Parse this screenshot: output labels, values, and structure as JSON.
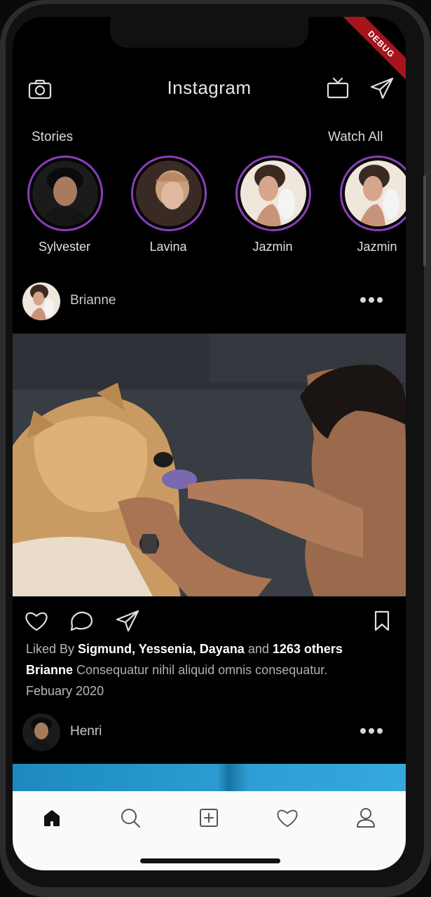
{
  "appbar": {
    "title": "Instagram",
    "left_icon": "camera-icon",
    "right_icons": [
      "tv-icon",
      "send-icon"
    ],
    "debug_banner": "DEBUG"
  },
  "stories": {
    "title": "Stories",
    "watch_all": "Watch All",
    "items": [
      {
        "name": "Sylvester"
      },
      {
        "name": "Lavina"
      },
      {
        "name": "Jazmin"
      },
      {
        "name": "Jazmin"
      }
    ],
    "ring_color": "#8a3fb8"
  },
  "posts": [
    {
      "user": "Brianne",
      "liked_prefix": "Liked By ",
      "liked_names": "Sigmund, Yessenia, Dayana",
      "liked_mid": " and ",
      "liked_others": "1263 others",
      "caption_user": "Brianne",
      "caption_text": " Consequatur nihil aliquid omnis consequatur.",
      "date": "Febuary 2020"
    },
    {
      "user": "Henri"
    }
  ],
  "bottom_nav": {
    "items": [
      "home-icon",
      "search-icon",
      "add-icon",
      "heart-icon",
      "profile-icon"
    ]
  }
}
